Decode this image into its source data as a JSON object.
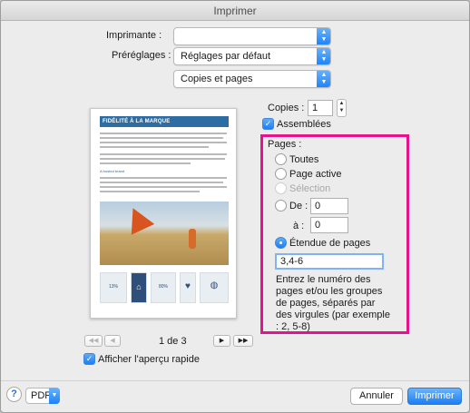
{
  "window": {
    "title": "Imprimer"
  },
  "printer": {
    "label": "Imprimante :",
    "value": ""
  },
  "presets": {
    "label": "Préréglages :",
    "value": "Réglages par défaut"
  },
  "section_popup": {
    "value": "Copies et pages"
  },
  "preview": {
    "doc_title": "FIDÉLITÉ À LA MARQUE",
    "subhead": "A trusted brand",
    "stats": [
      "13%",
      "80%"
    ],
    "page_indicator": "1 de 3",
    "first_label": "◀◀",
    "prev_label": "◀",
    "next_label": "▶",
    "last_label": "▶▶"
  },
  "show_preview": {
    "label": "Afficher l'aperçu rapide",
    "checked": true
  },
  "copies": {
    "label": "Copies :",
    "value": "1"
  },
  "collated": {
    "label": "Assemblées",
    "checked": true
  },
  "pages": {
    "heading": "Pages :",
    "options": {
      "all": "Toutes",
      "current": "Page active",
      "selection": "Sélection",
      "from": "De :",
      "to": "à :",
      "range": "Étendue de pages"
    },
    "from_value": "0",
    "to_value": "0",
    "range_value": "3,4-6",
    "selected": "range",
    "help_text": "Entrez le numéro des pages et/ou les groupes de pages, séparés par des virgules (par exemple : 2, 5-8)"
  },
  "bottom": {
    "help_symbol": "?",
    "pdf_label": "PDF",
    "cancel_label": "Annuler",
    "print_label": "Imprimer"
  },
  "colors": {
    "accent": "#1b7ff6",
    "highlight": "#e5148c",
    "brand_blue": "#2e6da4"
  },
  "icons": {
    "popup": "up-down-chevron-icon",
    "pdf_menu": "chevron-down-icon",
    "help": "help-icon"
  }
}
